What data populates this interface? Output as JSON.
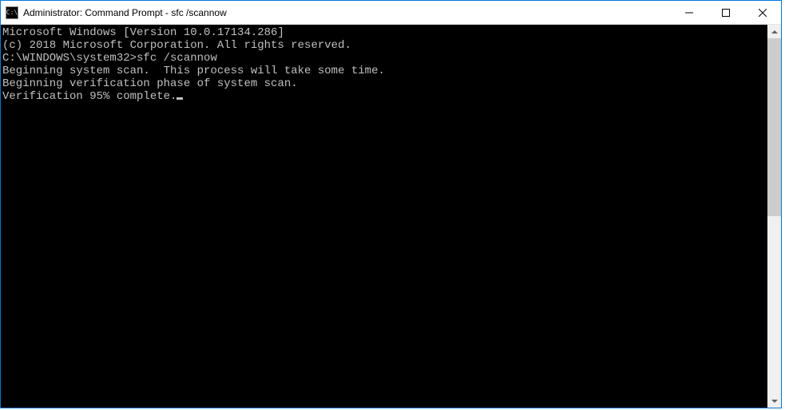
{
  "window": {
    "title": "Administrator: Command Prompt - sfc  /scannow"
  },
  "terminal": {
    "lines": [
      "Microsoft Windows [Version 10.0.17134.286]",
      "(c) 2018 Microsoft Corporation. All rights reserved.",
      "",
      "C:\\WINDOWS\\system32>sfc /scannow",
      "",
      "Beginning system scan.  This process will take some time.",
      "",
      "Beginning verification phase of system scan.",
      "Verification 95% complete."
    ]
  }
}
